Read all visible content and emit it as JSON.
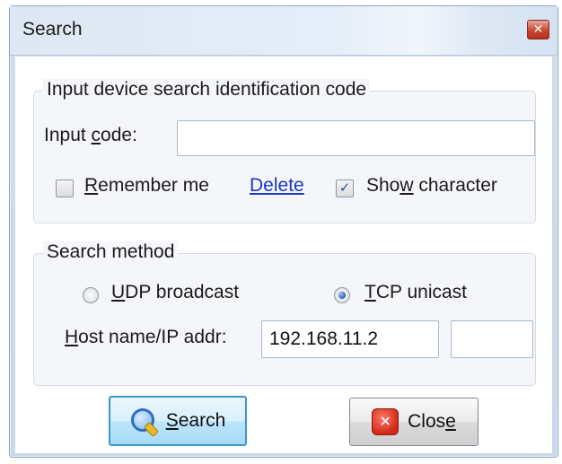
{
  "window": {
    "title": "Search"
  },
  "code_group": {
    "legend": "Input device search identification code",
    "input_label_pre": "Input ",
    "input_label_key": "c",
    "input_label_post": "ode:",
    "input_value": "",
    "remember_key": "R",
    "remember_rest": "emember me",
    "remember_checked": false,
    "delete_label": "Delete",
    "show_pre": "Sho",
    "show_key": "w",
    "show_post": " character",
    "show_checked": true
  },
  "method_group": {
    "legend": "Search method",
    "udp_key": "U",
    "udp_rest": "DP broadcast",
    "udp_selected": false,
    "tcp_key": "T",
    "tcp_rest": "CP unicast",
    "tcp_selected": true,
    "host_key": "H",
    "host_rest": "ost name/IP addr:",
    "host_value": "192.168.11.2",
    "port_value": ""
  },
  "buttons": {
    "search_key": "S",
    "search_rest": "earch",
    "close_pre": "Clos",
    "close_key": "e",
    "search_icon": "magnifier-icon",
    "close_icon": "close-x-icon"
  },
  "colors": {
    "link": "#1a35c8",
    "focus_border": "#3b95cf"
  }
}
